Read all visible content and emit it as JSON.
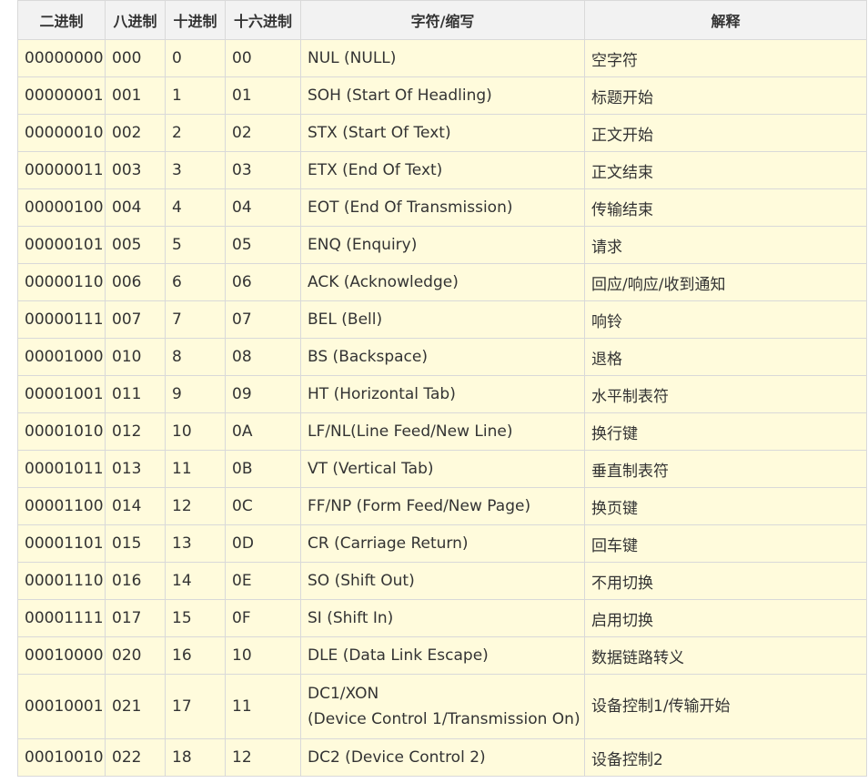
{
  "table": {
    "headers": [
      "二进制",
      "八进制",
      "十进制",
      "十六进制",
      "字符/缩写",
      "解释"
    ],
    "rows": [
      {
        "bin": "00000000",
        "oct": "000",
        "dec": "0",
        "hex": "00",
        "abbr": [
          "NUL (NULL)"
        ],
        "desc": "空字符"
      },
      {
        "bin": "00000001",
        "oct": "001",
        "dec": "1",
        "hex": "01",
        "abbr": [
          "SOH (Start Of Headling)"
        ],
        "desc": "标题开始"
      },
      {
        "bin": "00000010",
        "oct": "002",
        "dec": "2",
        "hex": "02",
        "abbr": [
          "STX (Start Of Text)"
        ],
        "desc": "正文开始"
      },
      {
        "bin": "00000011",
        "oct": "003",
        "dec": "3",
        "hex": "03",
        "abbr": [
          "ETX (End Of Text)"
        ],
        "desc": "正文结束"
      },
      {
        "bin": "00000100",
        "oct": "004",
        "dec": "4",
        "hex": "04",
        "abbr": [
          "EOT (End Of Transmission)"
        ],
        "desc": "传输结束"
      },
      {
        "bin": "00000101",
        "oct": "005",
        "dec": "5",
        "hex": "05",
        "abbr": [
          "ENQ (Enquiry)"
        ],
        "desc": "请求"
      },
      {
        "bin": "00000110",
        "oct": "006",
        "dec": "6",
        "hex": "06",
        "abbr": [
          "ACK (Acknowledge)"
        ],
        "desc": "回应/响应/收到通知"
      },
      {
        "bin": "00000111",
        "oct": "007",
        "dec": "7",
        "hex": "07",
        "abbr": [
          "BEL (Bell)"
        ],
        "desc": "响铃"
      },
      {
        "bin": "00001000",
        "oct": "010",
        "dec": "8",
        "hex": "08",
        "abbr": [
          "BS (Backspace)"
        ],
        "desc": "退格"
      },
      {
        "bin": "00001001",
        "oct": "011",
        "dec": "9",
        "hex": "09",
        "abbr": [
          "HT (Horizontal Tab)"
        ],
        "desc": "水平制表符"
      },
      {
        "bin": "00001010",
        "oct": "012",
        "dec": "10",
        "hex": "0A",
        "abbr": [
          "LF/NL(Line Feed/New Line)"
        ],
        "desc": "换行键"
      },
      {
        "bin": "00001011",
        "oct": "013",
        "dec": "11",
        "hex": "0B",
        "abbr": [
          "VT (Vertical Tab)"
        ],
        "desc": "垂直制表符"
      },
      {
        "bin": "00001100",
        "oct": "014",
        "dec": "12",
        "hex": "0C",
        "abbr": [
          "FF/NP (Form Feed/New Page)"
        ],
        "desc": "换页键"
      },
      {
        "bin": "00001101",
        "oct": "015",
        "dec": "13",
        "hex": "0D",
        "abbr": [
          "CR (Carriage Return)"
        ],
        "desc": "回车键"
      },
      {
        "bin": "00001110",
        "oct": "016",
        "dec": "14",
        "hex": "0E",
        "abbr": [
          "SO (Shift Out)"
        ],
        "desc": "不用切换"
      },
      {
        "bin": "00001111",
        "oct": "017",
        "dec": "15",
        "hex": "0F",
        "abbr": [
          "SI (Shift In)"
        ],
        "desc": "启用切换"
      },
      {
        "bin": "00010000",
        "oct": "020",
        "dec": "16",
        "hex": "10",
        "abbr": [
          "DLE (Data Link Escape)"
        ],
        "desc": "数据链路转义"
      },
      {
        "bin": "00010001",
        "oct": "021",
        "dec": "17",
        "hex": "11",
        "abbr": [
          "DC1/XON",
          "(Device Control 1/Transmission On)"
        ],
        "desc": "设备控制1/传输开始"
      },
      {
        "bin": "00010010",
        "oct": "022",
        "dec": "18",
        "hex": "12",
        "abbr": [
          "DC2 (Device Control 2)"
        ],
        "desc": "设备控制2"
      }
    ]
  }
}
